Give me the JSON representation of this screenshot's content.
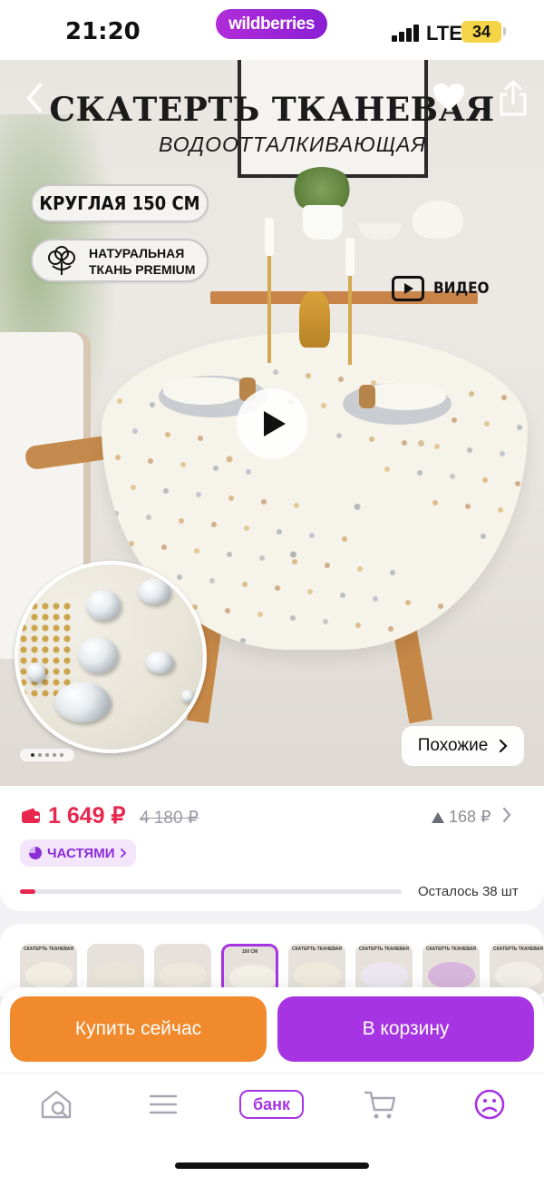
{
  "status_bar": {
    "time": "21:20",
    "app_pill": "wildberries",
    "network": "LTE",
    "battery": "34"
  },
  "product_image": {
    "title": "СКАТЕРТЬ ТКАНЕВАЯ",
    "subtitle": "ВОДООТТАЛКИВАЮЩАЯ",
    "size_badge": "КРУГЛАЯ 150 СМ",
    "fabric_badge_line1": "НАТУРАЛЬНАЯ",
    "fabric_badge_line2": "ТКАНЬ PREMIUM",
    "video_label": "ВИДЕО",
    "similar_button": "Похожие",
    "slide_count": 5,
    "active_slide": 1
  },
  "nav": {
    "back_icon": "chevron-left-icon",
    "favorite_icon": "heart-icon",
    "share_icon": "share-icon"
  },
  "price": {
    "current": "1 649 ₽",
    "old": "4 180 ₽",
    "change": "168 ₽",
    "installments_label": "ЧАСТЯМИ",
    "stock_text": "Осталось 38 шт",
    "stock_fraction": 0.04,
    "accent_color": "#e8274f"
  },
  "variants": {
    "items": [
      {
        "header": "СКАТЕРТЬ ТКАНЕВАЯ",
        "cloth": "#f1ede1"
      },
      {
        "header": "",
        "cloth": "#e9e4d7"
      },
      {
        "header": "",
        "cloth": "#ede7dc"
      },
      {
        "header": "150 СМ",
        "cloth": "#f2efe6"
      },
      {
        "header": "СКАТЕРТЬ ТКАНЕВАЯ",
        "cloth": "#efe9db"
      },
      {
        "header": "СКАТЕРТЬ ТКАНЕВАЯ",
        "cloth": "#ebe6f0"
      },
      {
        "header": "СКАТЕРТЬ ТКАНЕВАЯ",
        "cloth": "#d9b6dd"
      },
      {
        "header": "СКАТЕРТЬ ТКАНЕВАЯ",
        "cloth": "#f0eee6"
      }
    ],
    "selected_index": 3
  },
  "actions": {
    "buy_now": "Купить сейчас",
    "add_to_cart": "В корзину",
    "buy_color": "#f08a2c",
    "cart_color": "#a734e2"
  },
  "tab_bar": {
    "items": [
      {
        "icon": "home-search-icon"
      },
      {
        "icon": "menu-icon"
      },
      {
        "label": "банк"
      },
      {
        "icon": "cart-icon"
      },
      {
        "icon": "profile-icon"
      }
    ],
    "bank_label": "банк",
    "active_color": "#a734e2"
  }
}
